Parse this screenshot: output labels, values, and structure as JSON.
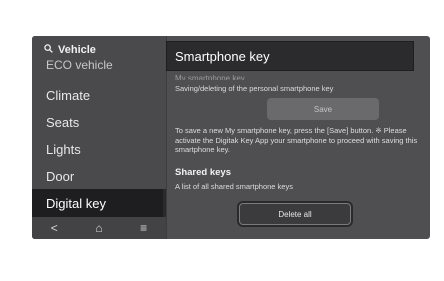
{
  "sidebar": {
    "search_label": "Vehicle",
    "items": [
      {
        "label": "ECO vehicle",
        "selected": false
      },
      {
        "label": "Climate",
        "selected": false
      },
      {
        "label": "Seats",
        "selected": false
      },
      {
        "label": "Lights",
        "selected": false
      },
      {
        "label": "Door",
        "selected": false
      },
      {
        "label": "Digital key",
        "selected": true
      }
    ],
    "nav": {
      "back": "<",
      "home": "⌂",
      "menu": "≡"
    }
  },
  "header": {
    "title": "Smartphone key"
  },
  "main": {
    "ghost_text": "My smartphone key",
    "save_subtitle": "Saving/deleting of the personal smartphone key",
    "save_label": "Save",
    "description": "To save a new My smartphone key, press the [Save] button. ※ Please activate the Digitak Key App your smartphone to proceed with saving this smartphone key.",
    "shared_title": "Shared keys",
    "shared_subtitle": "A list of all shared smartphone keys",
    "delete_all_label": "Delete all"
  },
  "colors": {
    "screen_bg": "#4f4f51",
    "selected_bg": "#1e1e20",
    "header_bg": "#2b2b2d"
  }
}
